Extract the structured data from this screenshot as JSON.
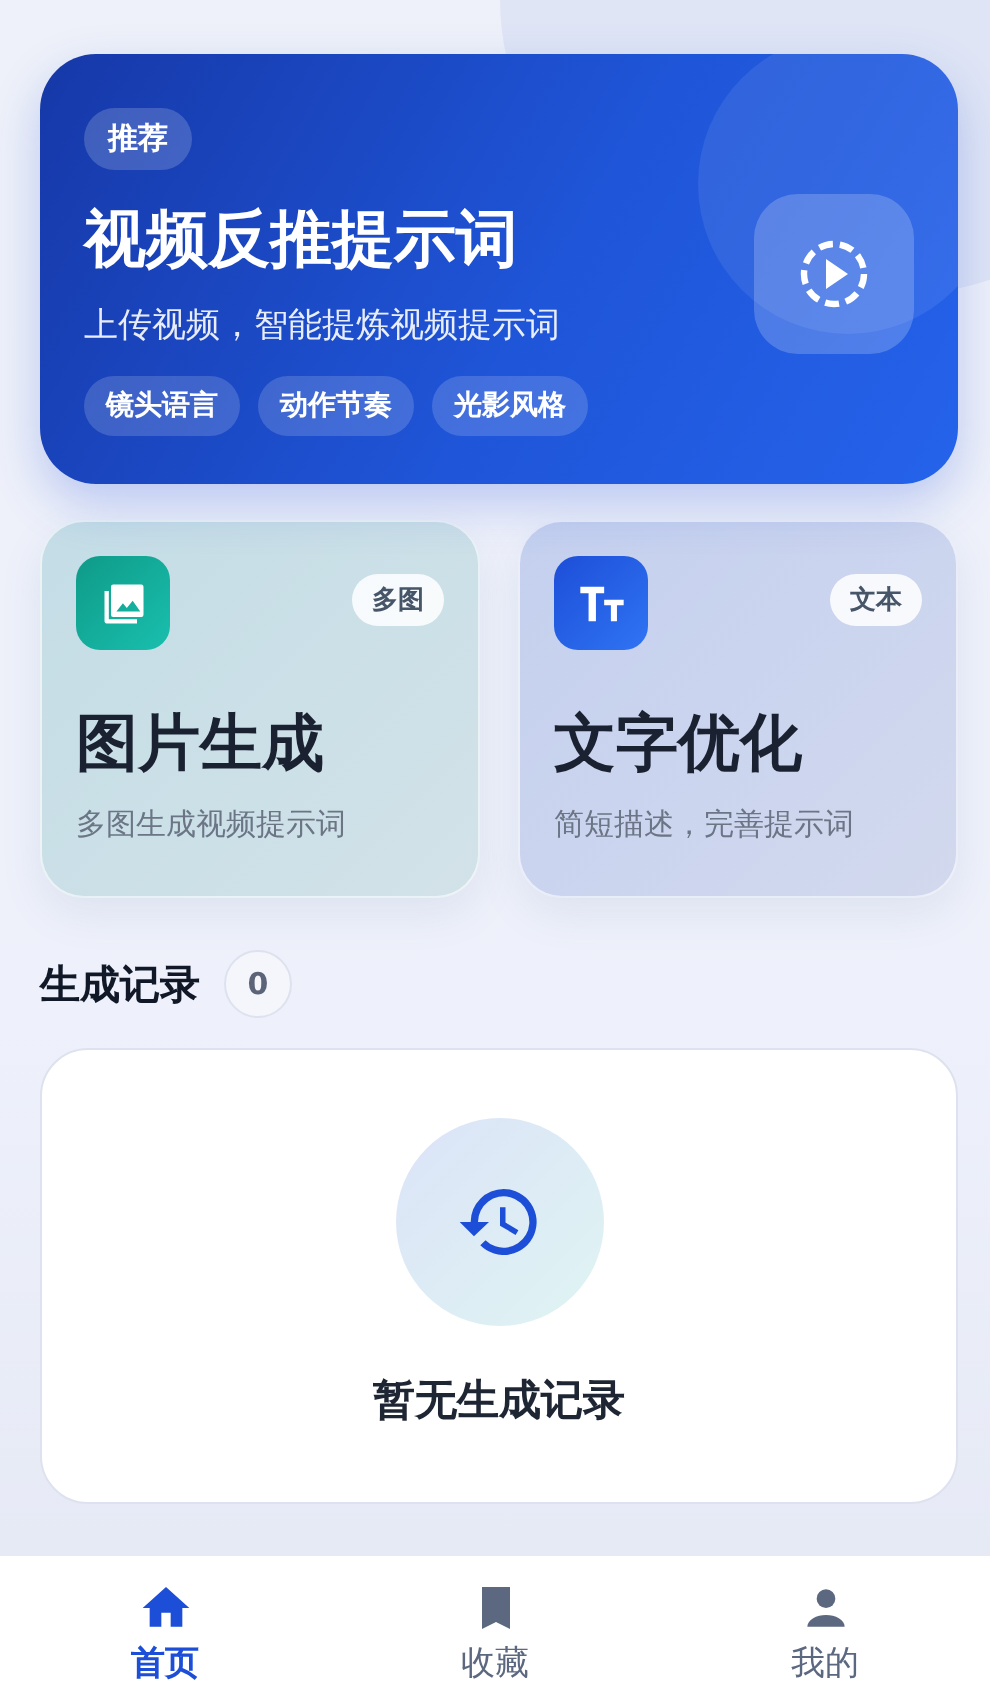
{
  "hero": {
    "badge": "推荐",
    "title": "视频反推提示词",
    "subtitle": "上传视频，智能提炼视频提示词",
    "tags": [
      "镜头语言",
      "动作节奏",
      "光影风格"
    ]
  },
  "features": [
    {
      "kind": "image",
      "badge": "多图",
      "title": "图片生成",
      "subtitle": "多图生成视频提示词"
    },
    {
      "kind": "text",
      "badge": "文本",
      "title": "文字优化",
      "subtitle": "简短描述，完善提示词"
    }
  ],
  "history": {
    "title": "生成记录",
    "count": "0",
    "empty_text": "暂无生成记录"
  },
  "tab_bar": [
    {
      "kind": "home",
      "label": "首页",
      "selected": true
    },
    {
      "kind": "bookmark",
      "label": "收藏",
      "selected": false
    },
    {
      "kind": "person",
      "label": "我的",
      "selected": false
    }
  ]
}
